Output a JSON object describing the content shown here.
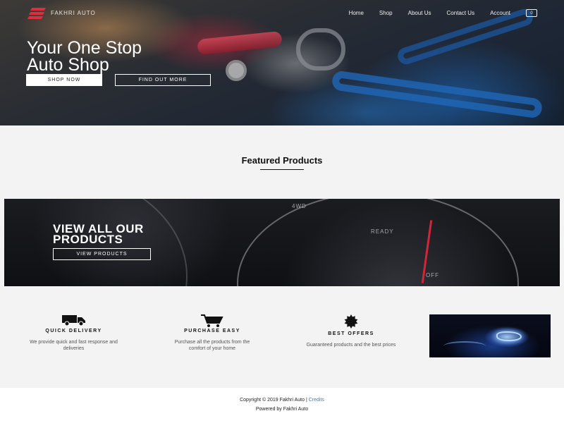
{
  "header": {
    "logo_text": "FAKHRI AUTO",
    "nav": [
      "Home",
      "Shop",
      "About Us",
      "Contact Us",
      "Account"
    ],
    "cart_count": "0"
  },
  "hero": {
    "title_line1": "Your One Stop",
    "title_line2": "Auto Shop",
    "primary_button": "SHOP NOW",
    "secondary_button": "FIND OUT MORE"
  },
  "featured": {
    "title": "Featured Products"
  },
  "banner": {
    "title_line1": "VIEW ALL OUR",
    "title_line2": "PRODUCTS",
    "button": "VIEW PRODUCTS",
    "gauge_labels": [
      "4WD",
      "READY",
      "OFF"
    ]
  },
  "features": [
    {
      "icon": "truck-icon",
      "title": "QUICK DELIVERY",
      "desc_line1": "We provide quick and fast response and",
      "desc_line2": "deliveries"
    },
    {
      "icon": "cart-icon",
      "title": "PURCHASE EASY",
      "desc_line1": "Purchase all the products from the",
      "desc_line2": "comfort of your home"
    },
    {
      "icon": "badge-icon",
      "title": "BEST OFFERS",
      "desc_line1": "Guaranteed products and the best prices",
      "desc_line2": ""
    }
  ],
  "footer": {
    "copyright": "Copyright © 2019 Fakhri Auto |",
    "credits": "Credits",
    "powered": "Powered by Fakhri Auto"
  },
  "colors": {
    "accent": "#e02c3c",
    "link": "#4a78b5",
    "page_bg": "#f3f3f3"
  }
}
